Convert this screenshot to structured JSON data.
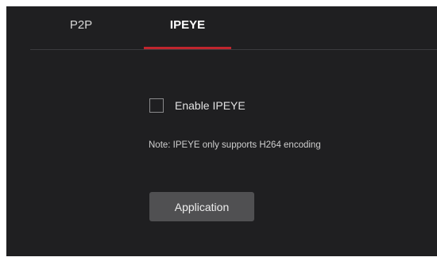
{
  "tabs": [
    {
      "label": "P2P",
      "active": false
    },
    {
      "label": "IPEYE",
      "active": true
    }
  ],
  "colors": {
    "background": "#1f1f21",
    "accent": "#c0262e",
    "button": "#505052"
  },
  "ipeye": {
    "enable_label": "Enable IPEYE",
    "enable_checked": false,
    "note": "Note: IPEYE only supports H264 encoding",
    "apply_label": "Application"
  }
}
